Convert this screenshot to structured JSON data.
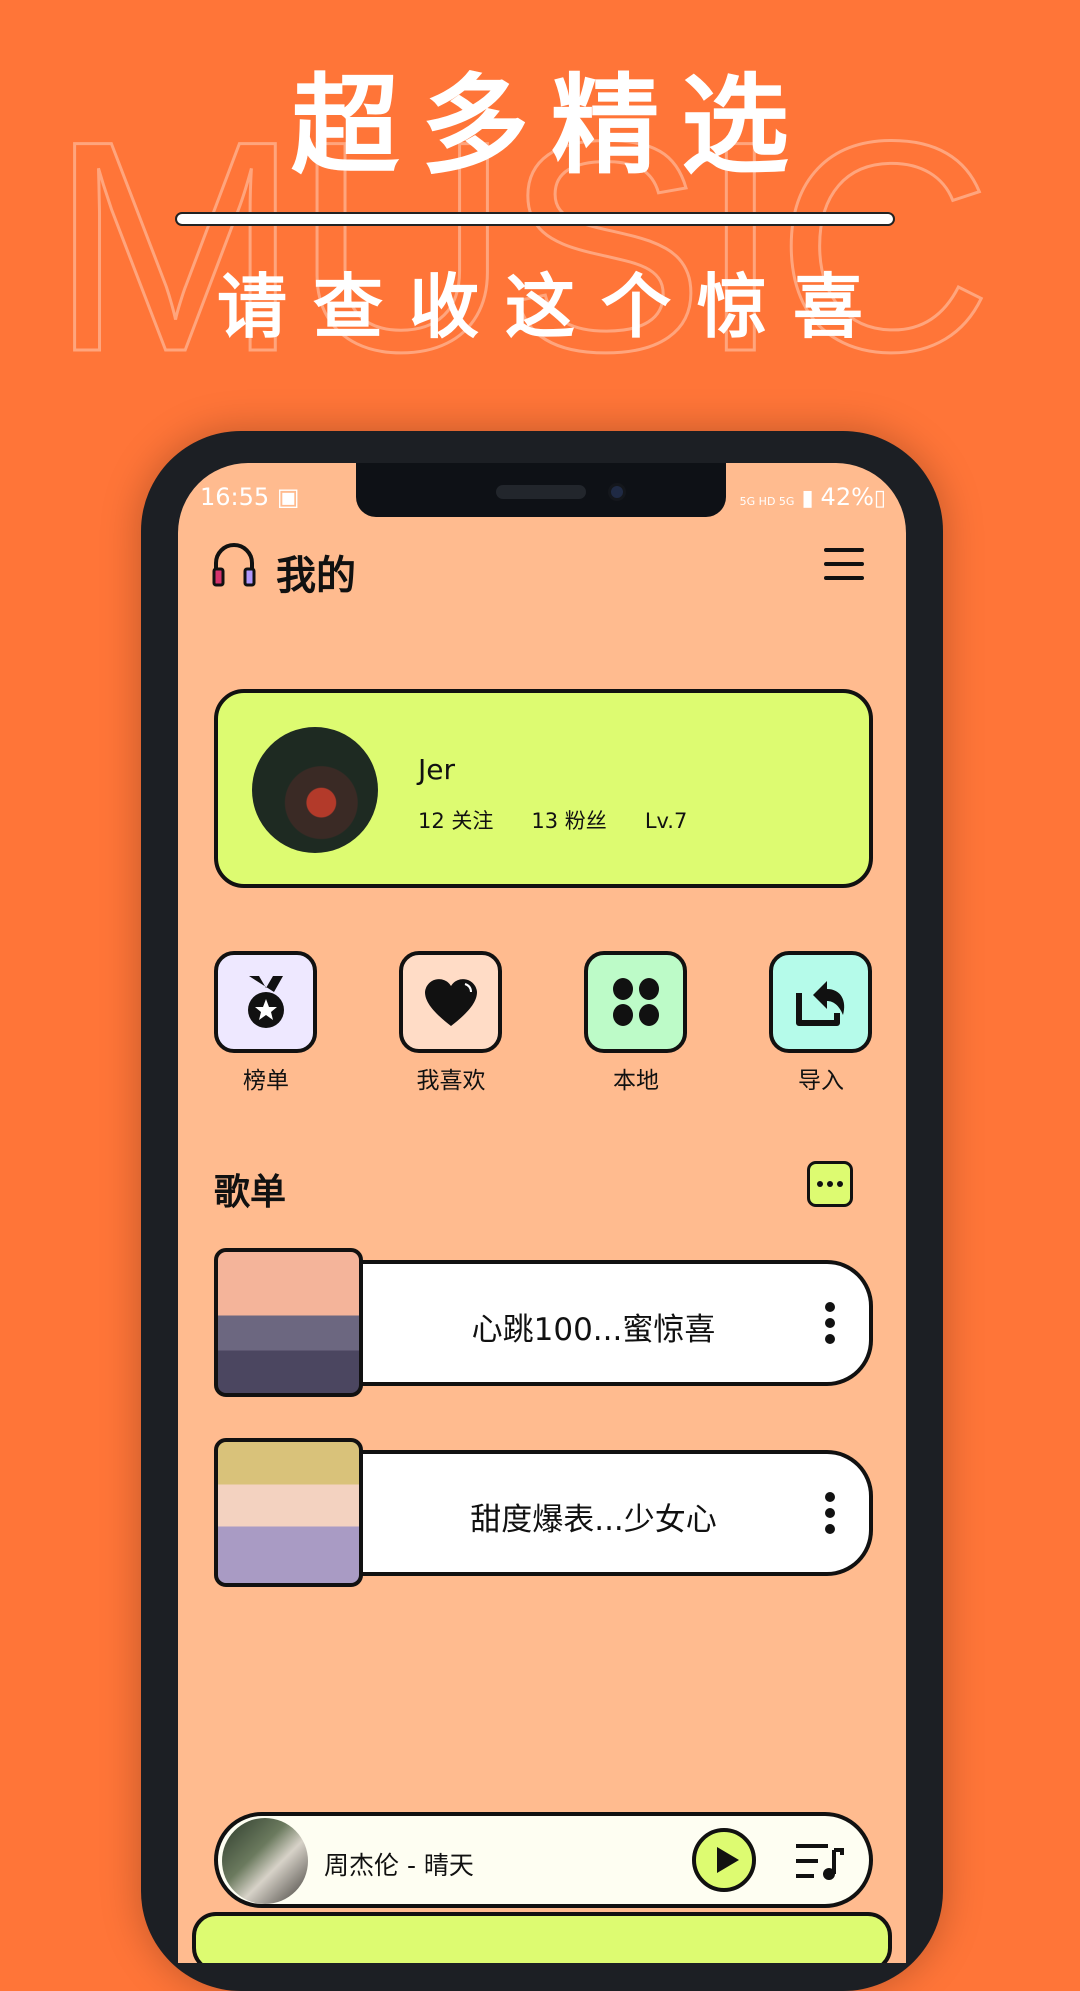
{
  "banner": {
    "watermark": "MUSIC",
    "title": "超多精选",
    "subtitle": "请查收这个惊喜"
  },
  "status_bar": {
    "time": "16:55",
    "network": "5G HD 5G",
    "battery": "42%"
  },
  "header": {
    "title": "我的",
    "icon": "headphones-icon",
    "menu_icon": "hamburger-menu-icon"
  },
  "profile": {
    "name": "Jer",
    "following": "12 关注",
    "followers": "13 粉丝",
    "level": "Lv.7"
  },
  "quick_actions": [
    {
      "label": "榜单",
      "icon": "medal-icon",
      "color": "#EEE8FF"
    },
    {
      "label": "我喜欢",
      "icon": "heart-icon",
      "color": "#FFDCC6"
    },
    {
      "label": "本地",
      "icon": "grid-icon",
      "color": "#BDFBC8"
    },
    {
      "label": "导入",
      "icon": "import-share-icon",
      "color": "#B5FBEA"
    }
  ],
  "playlists": {
    "title": "歌单",
    "items": [
      {
        "name": "心跳100...蜜惊喜"
      },
      {
        "name": "甜度爆表...少女心"
      }
    ]
  },
  "player": {
    "now_playing": "周杰伦 - 晴天"
  },
  "colors": {
    "background": "#FF7538",
    "screen": "#FFBB8F",
    "accent": "#DDFB71"
  }
}
